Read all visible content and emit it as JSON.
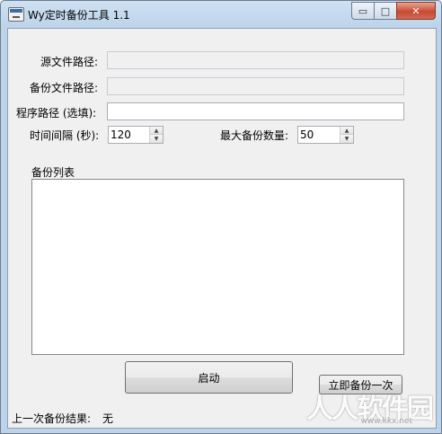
{
  "window": {
    "title": "Wy定时备份工具 1.1",
    "controls": {
      "minimize": "▭",
      "maximize": "□",
      "close": "✕"
    }
  },
  "form": {
    "source_label": "源文件路径:",
    "source_value": "",
    "backup_label": "备份文件路径:",
    "backup_value": "",
    "program_label": "程序路径 (选填):",
    "program_value": "",
    "interval_label": "时间间隔 (秒):",
    "interval_value": "120",
    "maxcount_label": "最大备份数量:",
    "maxcount_value": "50",
    "list_label": "备份列表"
  },
  "buttons": {
    "start": "启动",
    "backup_now": "立即备份一次"
  },
  "status": {
    "last_result_label": "上一次备份结果:",
    "last_result_value": "无"
  },
  "watermark": {
    "main": "人人软件园",
    "sub": "www.kkx.net"
  }
}
